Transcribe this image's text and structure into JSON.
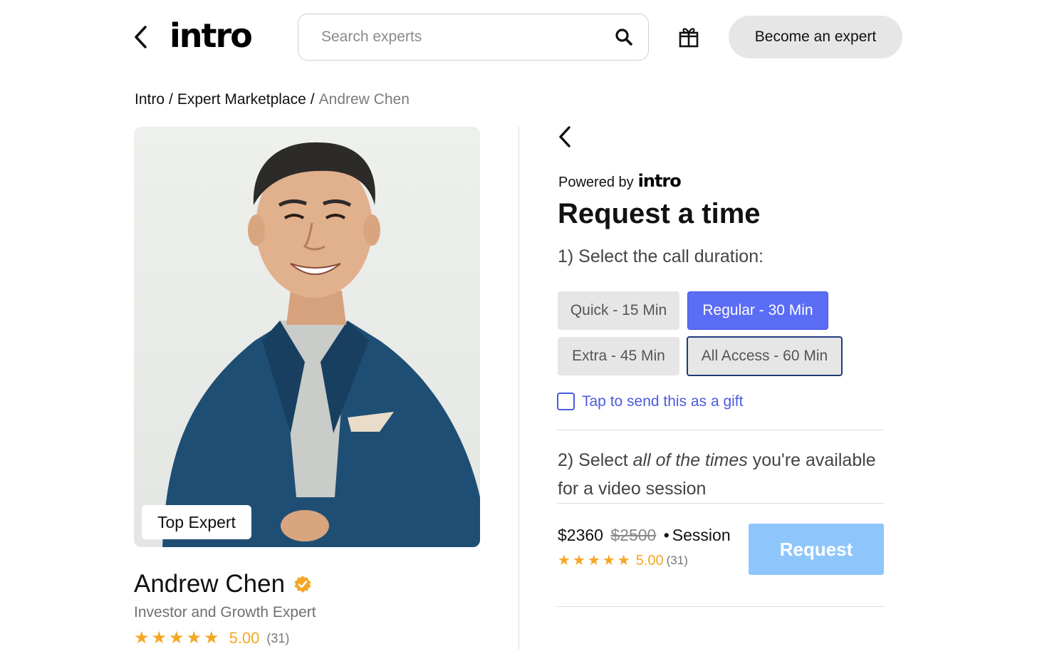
{
  "header": {
    "logo_text": "intro",
    "search_placeholder": "Search experts",
    "become_expert_label": "Become an expert",
    "icons": [
      "chevron-left-icon",
      "search-icon",
      "gift-icon"
    ]
  },
  "breadcrumb": {
    "items": [
      "Intro",
      "Expert Marketplace"
    ],
    "separator": "/",
    "current": "Andrew Chen"
  },
  "profile": {
    "badge": "Top Expert",
    "name": "Andrew Chen",
    "title": "Investor and Growth Expert",
    "rating": "5.00",
    "rating_count": "(31)",
    "star_count": 5
  },
  "booking": {
    "powered_by": "Powered by",
    "powered_logo": "intro",
    "title": "Request a time",
    "step1": "1) Select the call duration:",
    "durations": [
      {
        "label": "Quick - 15 Min",
        "state": "default"
      },
      {
        "label": "Regular - 30 Min",
        "state": "selected"
      },
      {
        "label": "Extra - 45 Min",
        "state": "default"
      },
      {
        "label": "All Access - 60 Min",
        "state": "focused"
      }
    ],
    "gift_label": "Tap to send this as a gift",
    "gift_checked": false,
    "step2_prefix": "2) Select ",
    "step2_emphasis": "all of the times",
    "step2_suffix": " you're available for a video session",
    "price": "$2360",
    "price_original": "$2500",
    "price_separator": "•",
    "price_unit": "Session",
    "rating": "5.00",
    "rating_count": "(31)",
    "request_label": "Request"
  },
  "colors": {
    "accent": "#5b6cf5",
    "star": "#f5a623",
    "request_button": "#8ec6fb",
    "gift_link": "#4b5bdc"
  }
}
